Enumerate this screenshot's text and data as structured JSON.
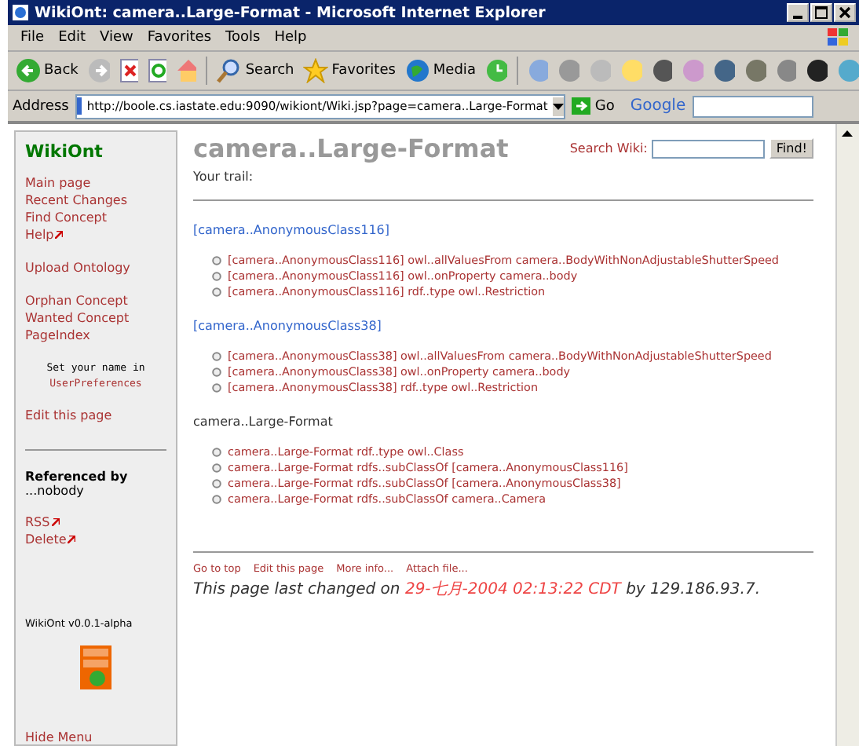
{
  "window": {
    "title": "WikiOnt: camera..Large-Format - Microsoft Internet Explorer"
  },
  "menu": [
    "File",
    "Edit",
    "View",
    "Favorites",
    "Tools",
    "Help"
  ],
  "toolbar": {
    "back": "Back",
    "search": "Search",
    "favorites": "Favorites",
    "media": "Media"
  },
  "address": {
    "label": "Address",
    "value": "http://boole.cs.iastate.edu:9090/wikiont/Wiki.jsp?page=camera..Large-Format",
    "go": "Go",
    "google": "Google"
  },
  "sidebar": {
    "title": "WikiOnt",
    "groups": [
      [
        {
          "label": "Main page",
          "external": false
        },
        {
          "label": "Recent Changes",
          "external": false
        },
        {
          "label": "Find Concept",
          "external": false
        },
        {
          "label": "Help",
          "external": true
        }
      ],
      [
        {
          "label": "Upload Ontology",
          "external": false
        }
      ],
      [
        {
          "label": "Orphan Concept",
          "external": false
        },
        {
          "label": "Wanted Concept",
          "external": false
        },
        {
          "label": "PageIndex",
          "external": false
        }
      ]
    ],
    "name_note": "Set your name in",
    "name_link": "UserPreferences",
    "edit": "Edit this page",
    "referenced_heading": "Referenced by",
    "referenced_value": "...nobody",
    "actions": [
      {
        "label": "RSS",
        "external": true
      },
      {
        "label": "Delete",
        "external": true
      }
    ],
    "version": "WikiOnt v0.0.1-alpha",
    "hide": "Hide Menu"
  },
  "page": {
    "title": "camera..Large-Format",
    "search_label": "Search Wiki:",
    "find": "Find!",
    "trail": "Your trail:",
    "sections": [
      {
        "kind": "link",
        "heading": "[camera..AnonymousClass116]",
        "items": [
          "[camera..AnonymousClass116] owl..allValuesFrom camera..BodyWithNonAdjustableShutterSpeed",
          "[camera..AnonymousClass116] owl..onProperty camera..body",
          "[camera..AnonymousClass116] rdf..type owl..Restriction"
        ]
      },
      {
        "kind": "link",
        "heading": "[camera..AnonymousClass38]",
        "items": [
          "[camera..AnonymousClass38] owl..allValuesFrom camera..BodyWithNonAdjustableShutterSpeed",
          "[camera..AnonymousClass38] owl..onProperty camera..body",
          "[camera..AnonymousClass38] rdf..type owl..Restriction"
        ]
      },
      {
        "kind": "plain",
        "heading": "camera..Large-Format",
        "items": [
          "camera..Large-Format rdf..type owl..Class",
          "camera..Large-Format rdfs..subClassOf [camera..AnonymousClass116]",
          "camera..Large-Format rdfs..subClassOf [camera..AnonymousClass38]",
          "camera..Large-Format rdfs..subClassOf camera..Camera"
        ]
      }
    ],
    "footer_links": [
      "Go to top",
      "Edit this page",
      "More info...",
      "Attach file..."
    ],
    "changed_prefix": "This page last changed on",
    "changed_date": "29-七月-2004 02:13:22 CDT",
    "changed_suffix": "by 129.186.93.7."
  }
}
